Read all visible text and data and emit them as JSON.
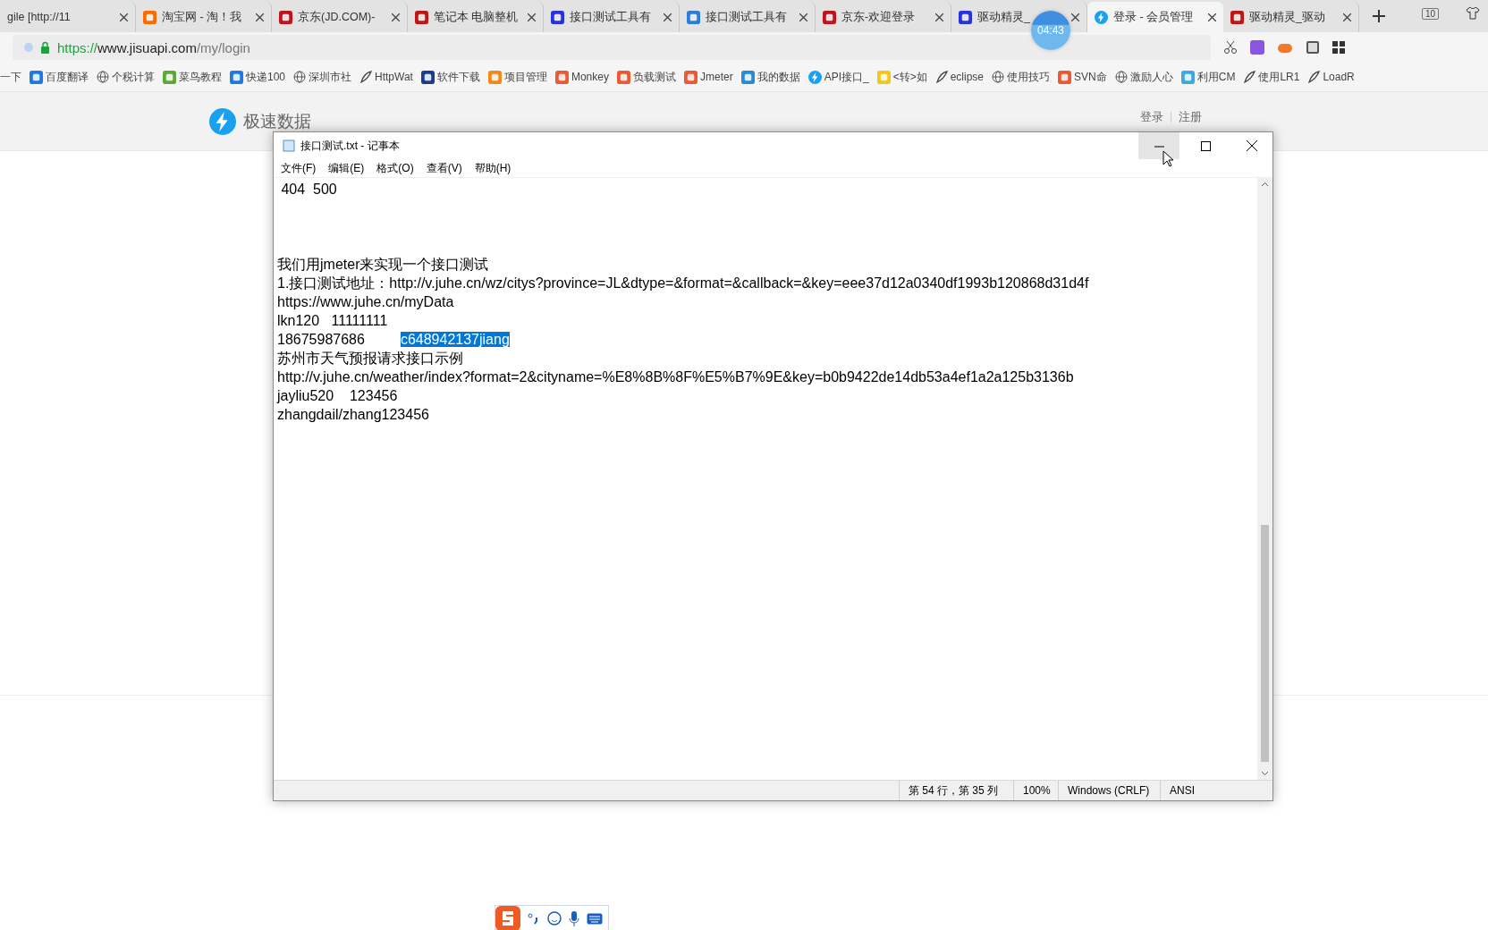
{
  "browser": {
    "tabs": [
      {
        "label": "gile [http://11",
        "kind": "none",
        "selected": false
      },
      {
        "label": "淘宝网 - 淘！我",
        "kind": "tao",
        "selected": false
      },
      {
        "label": "京东(JD.COM)-",
        "kind": "jd",
        "selected": false
      },
      {
        "label": "笔记本 电脑整机",
        "kind": "jd",
        "selected": false
      },
      {
        "label": "接口测试工具有",
        "kind": "paw",
        "selected": false
      },
      {
        "label": "接口测试工具有",
        "kind": "doc",
        "selected": false
      },
      {
        "label": "京东-欢迎登录",
        "kind": "jd",
        "selected": false
      },
      {
        "label": "驱动精灵_",
        "kind": "paw",
        "selected": false
      },
      {
        "label": "登录 - 会员管理",
        "kind": "bolt",
        "selected": true
      },
      {
        "label": "驱动精灵_驱动",
        "kind": "qu",
        "selected": false
      }
    ],
    "tab_count": "10",
    "timer": "04:43",
    "address": {
      "scheme": "https://",
      "host": "www.jisuapi.com",
      "path": "/my/login"
    },
    "bookmarks": [
      {
        "label": "一下",
        "kind": "none"
      },
      {
        "label": "百度翻译",
        "kind": "blue"
      },
      {
        "label": "个税计算",
        "kind": "globe"
      },
      {
        "label": "菜鸟教程",
        "kind": "green"
      },
      {
        "label": "快递100",
        "kind": "blue"
      },
      {
        "label": "深圳市社",
        "kind": "globe"
      },
      {
        "label": "HttpWat",
        "kind": "feather"
      },
      {
        "label": "软件下载",
        "kind": "navy"
      },
      {
        "label": "项目管理",
        "kind": "orange"
      },
      {
        "label": "Monkey",
        "kind": "red"
      },
      {
        "label": "负载测试",
        "kind": "red"
      },
      {
        "label": "Jmeter",
        "kind": "red"
      },
      {
        "label": "我的数据",
        "kind": "jm"
      },
      {
        "label": "API接口_",
        "kind": "bolt"
      },
      {
        "label": "<转>如",
        "kind": "yellow"
      },
      {
        "label": "eclipse",
        "kind": "feather"
      },
      {
        "label": "使用技巧",
        "kind": "globe"
      },
      {
        "label": "SVN命",
        "kind": "red"
      },
      {
        "label": "激励人心",
        "kind": "globe"
      },
      {
        "label": "利用CM",
        "kind": "wifi"
      },
      {
        "label": "使用LR1",
        "kind": "feather"
      },
      {
        "label": "LoadR",
        "kind": "feather"
      }
    ]
  },
  "site": {
    "logo": "极速数据",
    "links": [
      "登录",
      "注册"
    ]
  },
  "notepad": {
    "title": "接口测试.txt - 记事本",
    "menu": [
      "文件(F)",
      "编辑(E)",
      "格式(O)",
      "查看(V)",
      "帮助(H)"
    ],
    "blocks": [
      {
        "lines": [
          [
            {
              "text": " 404  500",
              "selected": false
            }
          ]
        ]
      },
      {
        "lines": [
          [
            {
              "text": "我们用jmeter来实现一个接口测试",
              "selected": false
            }
          ],
          [
            {
              "text": "1.接口测试地址：http://v.juhe.cn/wz/citys?province=JL&dtype=&format=&callback=&key=eee37d12a0340df1993b120868d31d4f",
              "selected": false
            }
          ],
          [
            {
              "text": "https://www.juhe.cn/myData",
              "selected": false
            }
          ],
          [
            {
              "text": "lkn120   11111111",
              "selected": false
            }
          ],
          [
            {
              "text": "18675987686         ",
              "selected": false
            },
            {
              "text": "c648942137jiang",
              "selected": true
            }
          ],
          [
            {
              "text": "苏州市天气预报请求接口示例",
              "selected": false
            }
          ],
          [
            {
              "text": "http://v.juhe.cn/weather/index?format=2&cityname=%E8%8B%8F%E5%B7%9E&key=b0b9422de14db53a4ef1a2a125b3136b",
              "selected": false
            }
          ],
          [
            {
              "text": "jayliu520    123456",
              "selected": false
            }
          ],
          [
            {
              "text": "zhangdail/zhang123456",
              "selected": false
            }
          ]
        ]
      }
    ],
    "status": [
      "第 54 行，第 35 列",
      "100%",
      "Windows (CRLF)",
      "ANSI"
    ]
  }
}
